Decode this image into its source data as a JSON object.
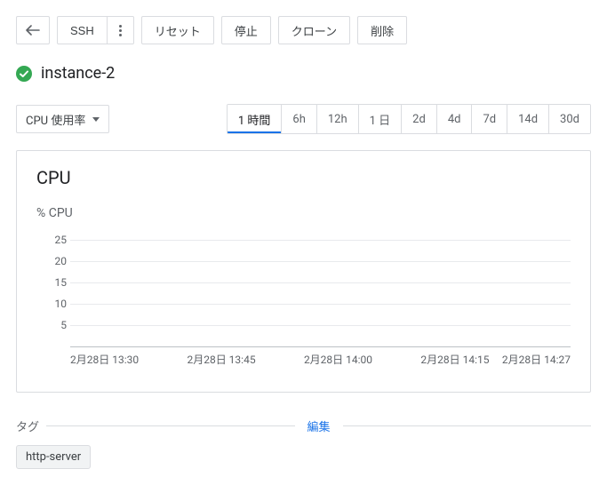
{
  "toolbar": {
    "ssh_label": "SSH",
    "reset_label": "リセット",
    "stop_label": "停止",
    "clone_label": "クローン",
    "delete_label": "削除"
  },
  "instance": {
    "name": "instance-2",
    "status": "running"
  },
  "metric_dropdown": {
    "selected": "CPU 使用率"
  },
  "time_range": {
    "options": [
      "1 時間",
      "6h",
      "12h",
      "1 日",
      "2d",
      "4d",
      "7d",
      "14d",
      "30d"
    ],
    "selected_index": 0
  },
  "chart_data": {
    "type": "line",
    "title": "CPU",
    "ylabel": "% CPU",
    "ylim": [
      0,
      27
    ],
    "yticks": [
      5,
      10,
      15,
      20,
      25
    ],
    "x": [
      "2月28日 13:30",
      "2月28日 13:45",
      "2月28日 14:00",
      "2月28日 14:15",
      "2月28日 14:27"
    ],
    "series": [
      {
        "name": "CPU",
        "values": [
          0,
          0,
          0,
          0,
          0
        ]
      }
    ]
  },
  "tags": {
    "section_label": "タグ",
    "edit_label": "編集",
    "items": [
      "http-server"
    ]
  }
}
